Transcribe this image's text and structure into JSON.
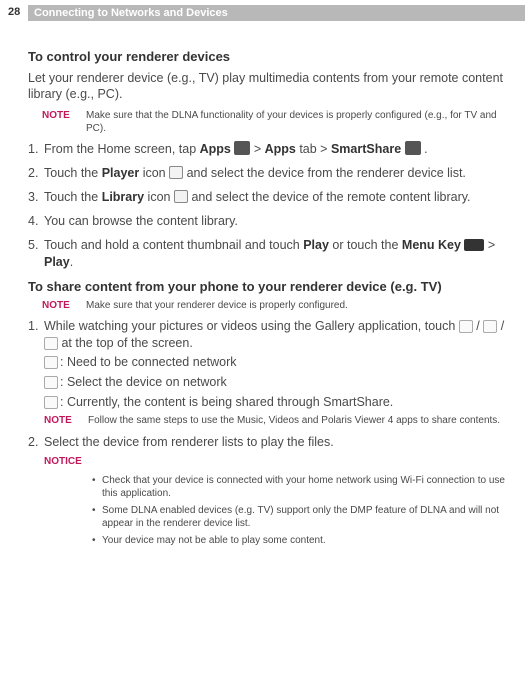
{
  "page_number": "28",
  "header": "Connecting to Networks and Devices",
  "section1": {
    "title": "To control your renderer devices",
    "intro": "Let your renderer device (e.g., TV) play multimedia contents from your remote content library (e.g., PC).",
    "note_label": "NOTE",
    "note": "Make sure that the DLNA functionality of your devices is properly configured (e.g., for TV and PC).",
    "steps": [
      {
        "pre": "From the Home screen, tap ",
        "b1": "Apps",
        "mid1": " ",
        "gt1": " > ",
        "b2": "Apps",
        "mid2": " tab > ",
        "b3": "SmartShare",
        "post": " ."
      },
      {
        "pre": "Touch the ",
        "b1": "Player",
        "mid1": " icon ",
        "post": " and select the device from the renderer device list."
      },
      {
        "pre": "Touch the ",
        "b1": "Library",
        "mid1": " icon ",
        "post": " and select the device of the remote content library."
      },
      {
        "text": "You can browse the content library."
      },
      {
        "pre": "Touch and hold a content thumbnail and touch ",
        "b1": "Play",
        "mid1": " or touch the ",
        "b2": "Menu Key",
        "mid2": " ",
        "gt1": " > ",
        "b3": "Play",
        "post": "."
      }
    ]
  },
  "section2": {
    "title": "To share content from your phone to your renderer device (e.g. TV)",
    "note_label": "NOTE",
    "note1": "Make sure that your renderer device is properly configured.",
    "step1_pre": "While watching your pictures or videos using the Gallery application, touch ",
    "step1_mid": " / ",
    "step1_post": " at the top of the screen.",
    "iconline1": ": Need to be connected network",
    "iconline2": ": Select the device on network",
    "iconline3": ": Currently, the content is being shared through SmartShare.",
    "note2": "Follow the same steps to use the Music, Videos and Polaris Viewer 4 apps to share contents.",
    "step2": "Select the device from renderer lists to play the files.",
    "notice_label": "NOTICE",
    "notice_bullets": [
      "Check that your device is connected with your home network using Wi-Fi connection to use this application.",
      "Some DLNA enabled devices (e.g. TV) support only the DMP feature of DLNA and will not appear in the renderer device list.",
      "Your device may not be able to play some content."
    ]
  }
}
